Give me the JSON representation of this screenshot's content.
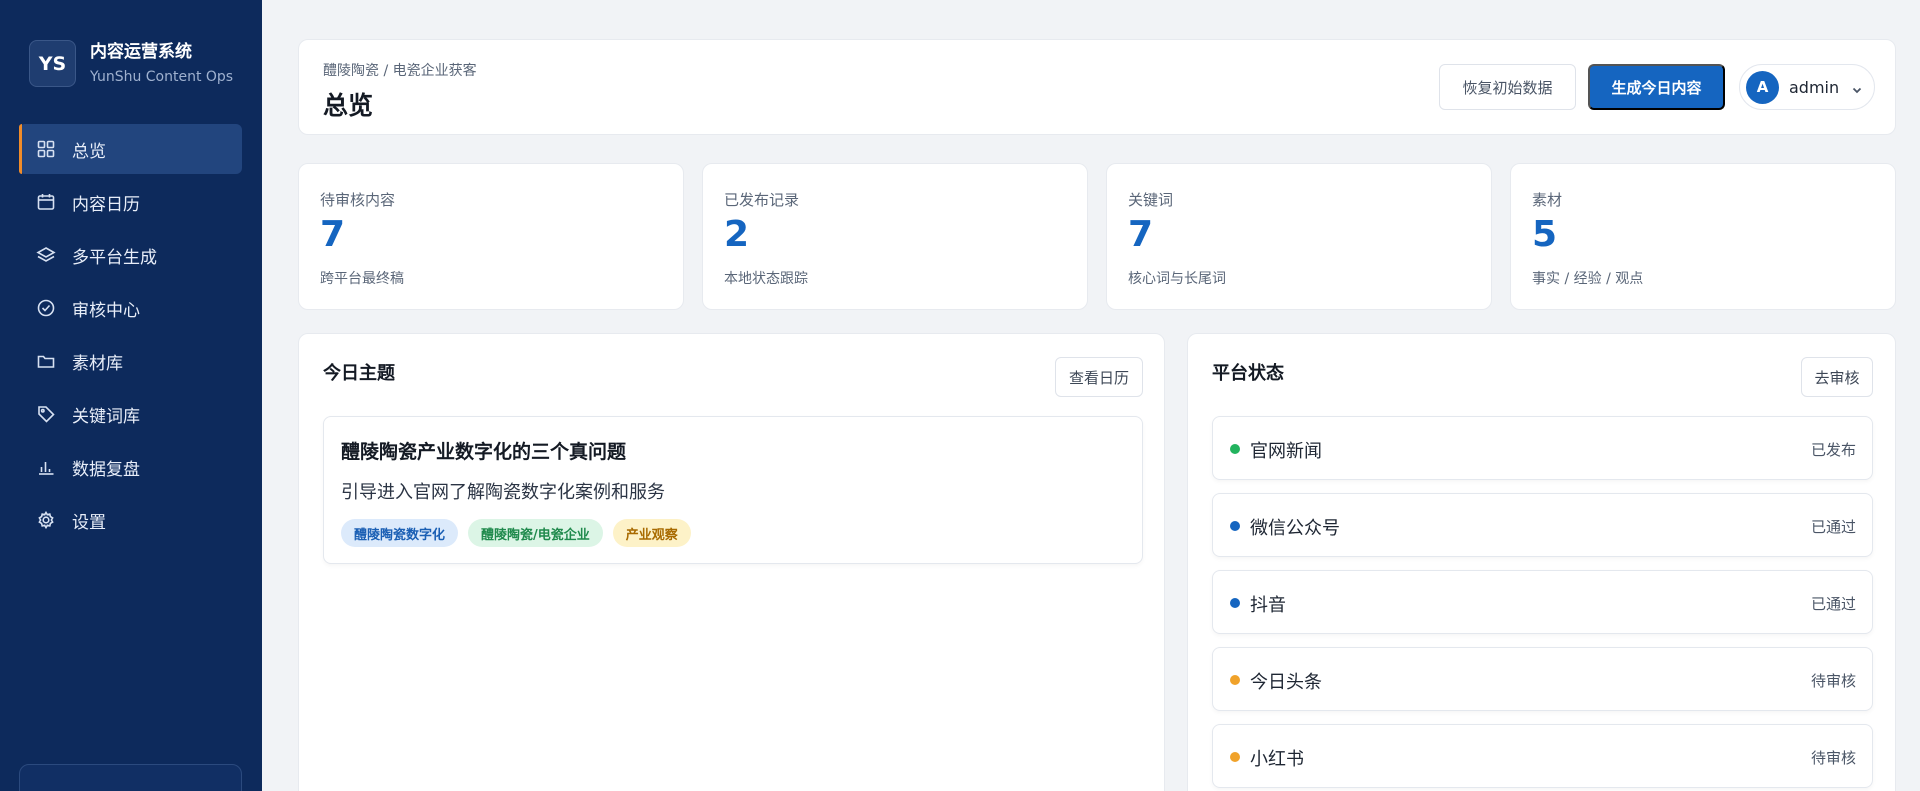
{
  "brand": {
    "logo_text": "YS",
    "name": "内容运营系统",
    "subtitle": "YunShu Content Ops"
  },
  "sidebar": {
    "items": [
      {
        "label": "总览",
        "icon": "grid-icon",
        "active": true
      },
      {
        "label": "内容日历",
        "icon": "calendar-icon",
        "active": false
      },
      {
        "label": "多平台生成",
        "icon": "layers-icon",
        "active": false
      },
      {
        "label": "审核中心",
        "icon": "check-circle-icon",
        "active": false
      },
      {
        "label": "素材库",
        "icon": "folder-icon",
        "active": false
      },
      {
        "label": "关键词库",
        "icon": "tag-icon",
        "active": false
      },
      {
        "label": "数据复盘",
        "icon": "bar-chart-icon",
        "active": false
      },
      {
        "label": "设置",
        "icon": "gear-icon",
        "active": false
      }
    ]
  },
  "header": {
    "breadcrumb": "醴陵陶瓷 / 电瓷企业获客",
    "title": "总览",
    "reset_label": "恢复初始数据",
    "generate_label": "生成今日内容",
    "user": {
      "avatar_letter": "A",
      "name": "admin"
    }
  },
  "stats": [
    {
      "label": "待审核内容",
      "value": "7",
      "desc": "跨平台最终稿"
    },
    {
      "label": "已发布记录",
      "value": "2",
      "desc": "本地状态跟踪"
    },
    {
      "label": "关键词",
      "value": "7",
      "desc": "核心词与长尾词"
    },
    {
      "label": "素材",
      "value": "5",
      "desc": "事实 / 经验 / 观点"
    }
  ],
  "topic_panel": {
    "title": "今日主题",
    "button_label": "查看日历",
    "topic": {
      "title": "醴陵陶瓷产业数字化的三个真问题",
      "subtitle": "引导进入官网了解陶瓷数字化案例和服务",
      "tags": [
        {
          "label": "醴陵陶瓷数字化",
          "bg": "#dceafb",
          "color": "#1a5fb4"
        },
        {
          "label": "醴陵陶瓷/电瓷企业",
          "bg": "#dcf5e6",
          "color": "#1f8a4c"
        },
        {
          "label": "产业观察",
          "bg": "#fdf2c8",
          "color": "#a86a00"
        }
      ]
    }
  },
  "platform_panel": {
    "title": "平台状态",
    "button_label": "去审核",
    "rows": [
      {
        "name": "官网新闻",
        "status": "已发布",
        "dot_color": "#22b35e"
      },
      {
        "name": "微信公众号",
        "status": "已通过",
        "dot_color": "#1565c0"
      },
      {
        "name": "抖音",
        "status": "已通过",
        "dot_color": "#1565c0"
      },
      {
        "name": "今日头条",
        "status": "待审核",
        "dot_color": "#f0a22a"
      },
      {
        "name": "小红书",
        "status": "待审核",
        "dot_color": "#f0a22a"
      }
    ]
  }
}
